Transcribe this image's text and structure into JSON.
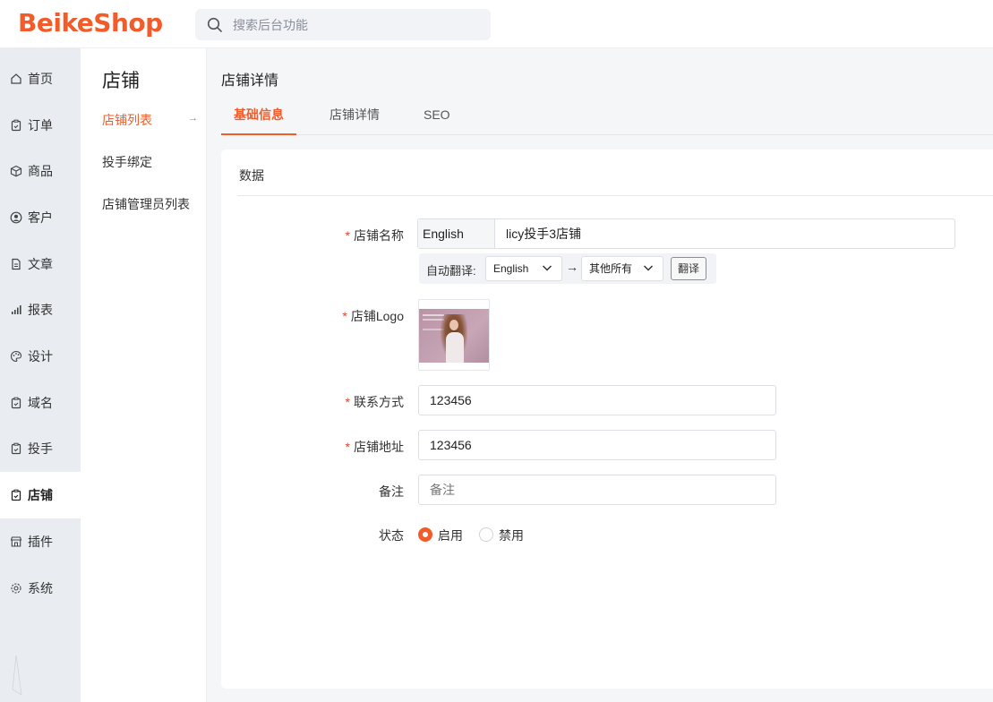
{
  "app": {
    "logo": "BeikeShop"
  },
  "search": {
    "placeholder": "搜索后台功能"
  },
  "leftnav": {
    "items": [
      {
        "label": "首页",
        "icon": "home-icon"
      },
      {
        "label": "订单",
        "icon": "clipboard-icon"
      },
      {
        "label": "商品",
        "icon": "box-icon"
      },
      {
        "label": "客户",
        "icon": "user-circle-icon"
      },
      {
        "label": "文章",
        "icon": "document-icon"
      },
      {
        "label": "报表",
        "icon": "bar-chart-icon"
      },
      {
        "label": "设计",
        "icon": "palette-icon"
      },
      {
        "label": "域名",
        "icon": "clipboard-icon"
      },
      {
        "label": "投手",
        "icon": "clipboard-icon"
      },
      {
        "label": "店铺",
        "icon": "clipboard-icon",
        "active": true
      },
      {
        "label": "插件",
        "icon": "store-icon"
      },
      {
        "label": "系统",
        "icon": "gear-icon"
      }
    ]
  },
  "subnav": {
    "title": "店铺",
    "items": [
      {
        "label": "店铺列表",
        "active": true
      },
      {
        "label": "投手绑定"
      },
      {
        "label": "店铺管理员列表"
      }
    ],
    "active_arrow": "→"
  },
  "page": {
    "title": "店铺详情",
    "tabs": [
      {
        "label": "基础信息",
        "active": true
      },
      {
        "label": "店铺详情"
      },
      {
        "label": "SEO"
      }
    ]
  },
  "form": {
    "section_title": "数据",
    "required_mark": "*",
    "store_name": {
      "label": "店铺名称",
      "lang_prefix": "English",
      "value": "licy投手3店铺"
    },
    "translate": {
      "label": "自动翻译:",
      "from": "English",
      "arrow": "→",
      "to": "其他所有",
      "button": "翻译"
    },
    "logo": {
      "label": "店铺Logo"
    },
    "contact": {
      "label": "联系方式",
      "value": "123456"
    },
    "address": {
      "label": "店铺地址",
      "value": "123456"
    },
    "remark": {
      "label": "备注",
      "placeholder": "备注",
      "value": ""
    },
    "status": {
      "label": "状态",
      "options": [
        {
          "label": "启用",
          "checked": true
        },
        {
          "label": "禁用",
          "checked": false
        }
      ]
    }
  },
  "colors": {
    "accent": "#f25c2a",
    "nav_bg": "#e9ecf1",
    "required": "#e0442e"
  }
}
